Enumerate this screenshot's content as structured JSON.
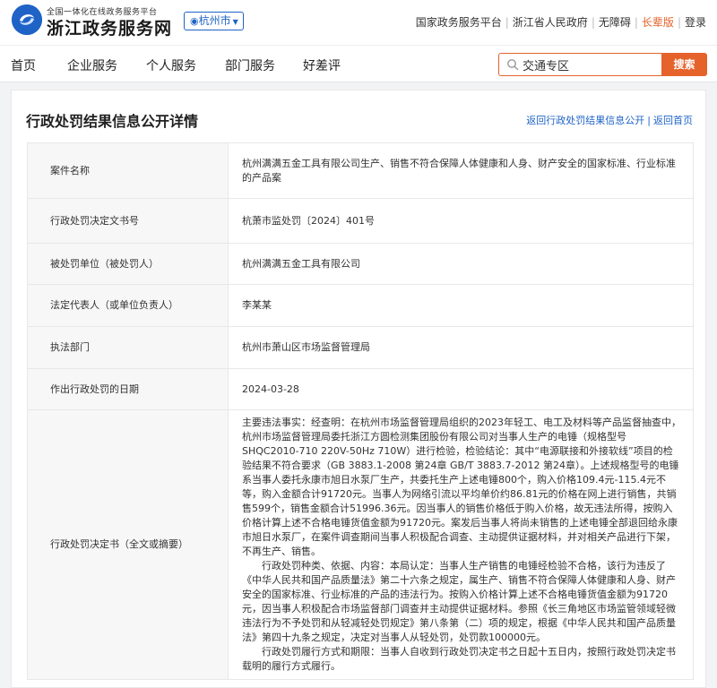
{
  "header": {
    "logo_subtitle": "全国一体化在线政务服务平台",
    "logo_title": "浙江政务服务网",
    "city": "杭州市",
    "top_links": [
      {
        "label": "国家政务服务平台",
        "active": false
      },
      {
        "label": "浙江省人民政府",
        "active": false
      },
      {
        "label": "无障碍",
        "active": false
      },
      {
        "label": "长辈版",
        "active": true
      },
      {
        "label": "登录",
        "active": false
      }
    ]
  },
  "nav": {
    "items": [
      "首页",
      "企业服务",
      "个人服务",
      "部门服务",
      "好差评"
    ],
    "search": {
      "value": "交通专区",
      "button": "搜索"
    }
  },
  "page": {
    "title": "行政处罚结果信息公开详情",
    "back_list": "返回行政处罚结果信息公开",
    "back_home": "返回首页"
  },
  "table": {
    "rows": [
      {
        "label": "案件名称",
        "value": "杭州满满五金工具有限公司生产、销售不符合保障人体健康和人身、财产安全的国家标准、行业标准的产品案"
      },
      {
        "label": "行政处罚决定文书号",
        "value": "杭萧市监处罚〔2024〕401号"
      },
      {
        "label": "被处罚单位（被处罚人）",
        "value": "杭州满满五金工具有限公司"
      },
      {
        "label": "法定代表人（或单位负责人）",
        "value": "李某某"
      },
      {
        "label": "执法部门",
        "value": "杭州市萧山区市场监督管理局"
      },
      {
        "label": "作出行政处罚的日期",
        "value": "2024-03-28"
      }
    ],
    "decision": {
      "label": "行政处罚决定书（全文或摘要）",
      "paragraphs": [
        "主要违法事实：经查明：在杭州市场监督管理局组织的2023年轻工、电工及材料等产品监督抽查中，杭州市场监督管理局委托浙江方圆检测集团股份有限公司对当事人生产的电锤（规格型号SHQC2010-710 220V-50Hz 710W）进行检验，检验结论：其中“电源联接和外接软线”项目的检验结果不符合要求（GB 3883.1-2008 第24章 GB/T 3883.7-2012 第24章）。上述规格型号的电锤系当事人委托永康市旭日水泵厂生产，共委托生产上述电锤800个，购入价格109.4元-115.4元不等，购入金额合计91720元。当事人为网络引流以平均单价约86.81元的价格在网上进行销售，共销售599个，销售金额合计51996.36元。因当事人的销售价格低于购入价格，故无违法所得，按购入价格计算上述不合格电锤货值金额为91720元。案发后当事人将尚未销售的上述电锤全部退回给永康市旭日水泵厂，在案件调查期间当事人积极配合调查、主动提供证据材料，并对相关产品进行下架，不再生产、销售。",
        "行政处罚种类、依据、内容：本局认定：当事人生产销售的电锤经检验不合格，该行为违反了《中华人民共和国产品质量法》第二十六条之规定，属生产、销售不符合保障人体健康和人身、财产安全的国家标准、行业标准的产品的违法行为。按购入价格计算上述不合格电锤货值金额为91720元，因当事人积极配合市场监督部门调查并主动提供证据材料。参照《长三角地区市场监管领域轻微违法行为不予处罚和从轻减轻处罚规定》第八条第（二）项的规定，根据《中华人民共和国产品质量法》第四十九条之规定，决定对当事人从轻处罚，处罚款100000元。",
        "行政处罚履行方式和期限：当事人自收到行政处罚决定书之日起十五日内，按照行政处罚决定书载明的履行方式履行。"
      ]
    }
  },
  "colors": {
    "brand": "#1f63c6",
    "accent": "#e5622a"
  }
}
